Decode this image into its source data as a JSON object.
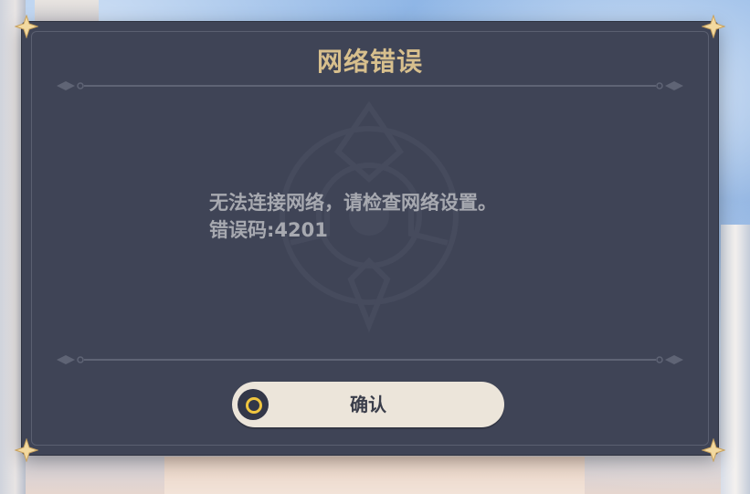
{
  "dialog": {
    "title": "网络错误",
    "message_line1": "无法连接网络，请检查网络设置。",
    "message_line2": "错误码:4201",
    "confirm_label": "确认",
    "confirm_icon": "circle-button-icon"
  },
  "colors": {
    "panel_bg": "#3f4456",
    "title_gold": "#d7bf8d",
    "message_text": "#a7a9b0",
    "button_bg": "#ece5da",
    "button_icon_ring": "#f0c53f"
  }
}
